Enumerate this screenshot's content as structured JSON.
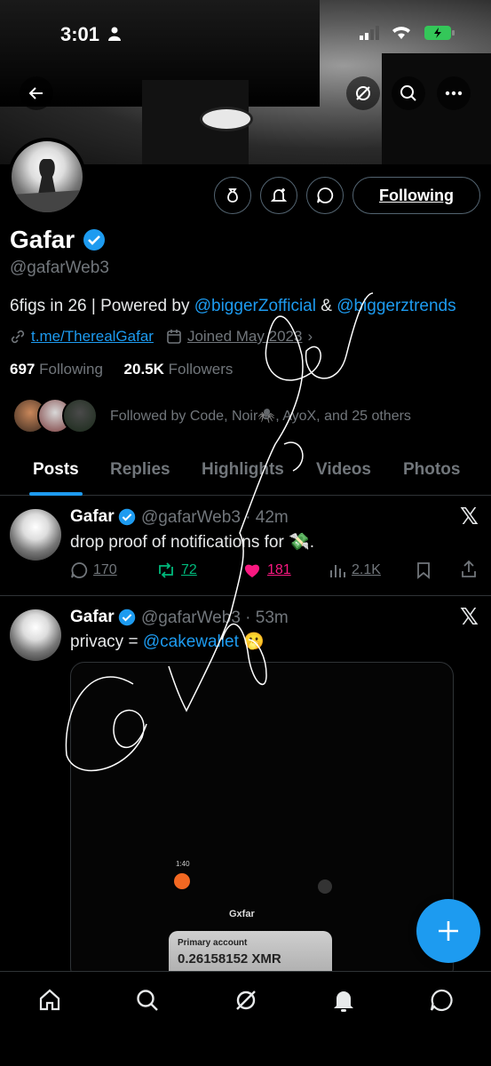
{
  "status_bar": {
    "time": "3:01"
  },
  "profile": {
    "name": "Gafar",
    "handle": "@gafarWeb3",
    "bio_prefix": "6figs in 26 | Powered by ",
    "bio_mention1": "@biggerZofficial",
    "bio_amp": " & ",
    "bio_mention2": "@biggerztrends",
    "link": "t.me/TherealGafar",
    "joined": "Joined May 2023",
    "following_count": "697",
    "following_label": "Following",
    "followers_count": "20.5K",
    "followers_label": "Followers",
    "followed_by": "Followed by Code, Noir🕷️, AyoX, and 25 others",
    "following_button": "Following"
  },
  "tabs": [
    "Posts",
    "Replies",
    "Highlights",
    "Videos",
    "Photos"
  ],
  "posts": [
    {
      "name": "Gafar",
      "handle_time": "@gafarWeb3 · 42m",
      "text": "drop proof of notifications for 💸.",
      "replies": "170",
      "reposts": "72",
      "likes": "181",
      "views": "2.1K"
    },
    {
      "name": "Gafar",
      "handle_time": "@gafarWeb3 · 53m",
      "text_prefix": "privacy = ",
      "text_mention": "@cakewallet",
      "text_suffix": " 🫢",
      "media": {
        "phone_time": "1:40",
        "wallet_name": "Gxfar",
        "account_label": "Primary account",
        "balance": "0.26158152 XMR"
      }
    }
  ],
  "colors": {
    "accent": "#1d9bf0",
    "like": "#f91880",
    "repost": "#00ba7c",
    "muted": "#71767b"
  }
}
